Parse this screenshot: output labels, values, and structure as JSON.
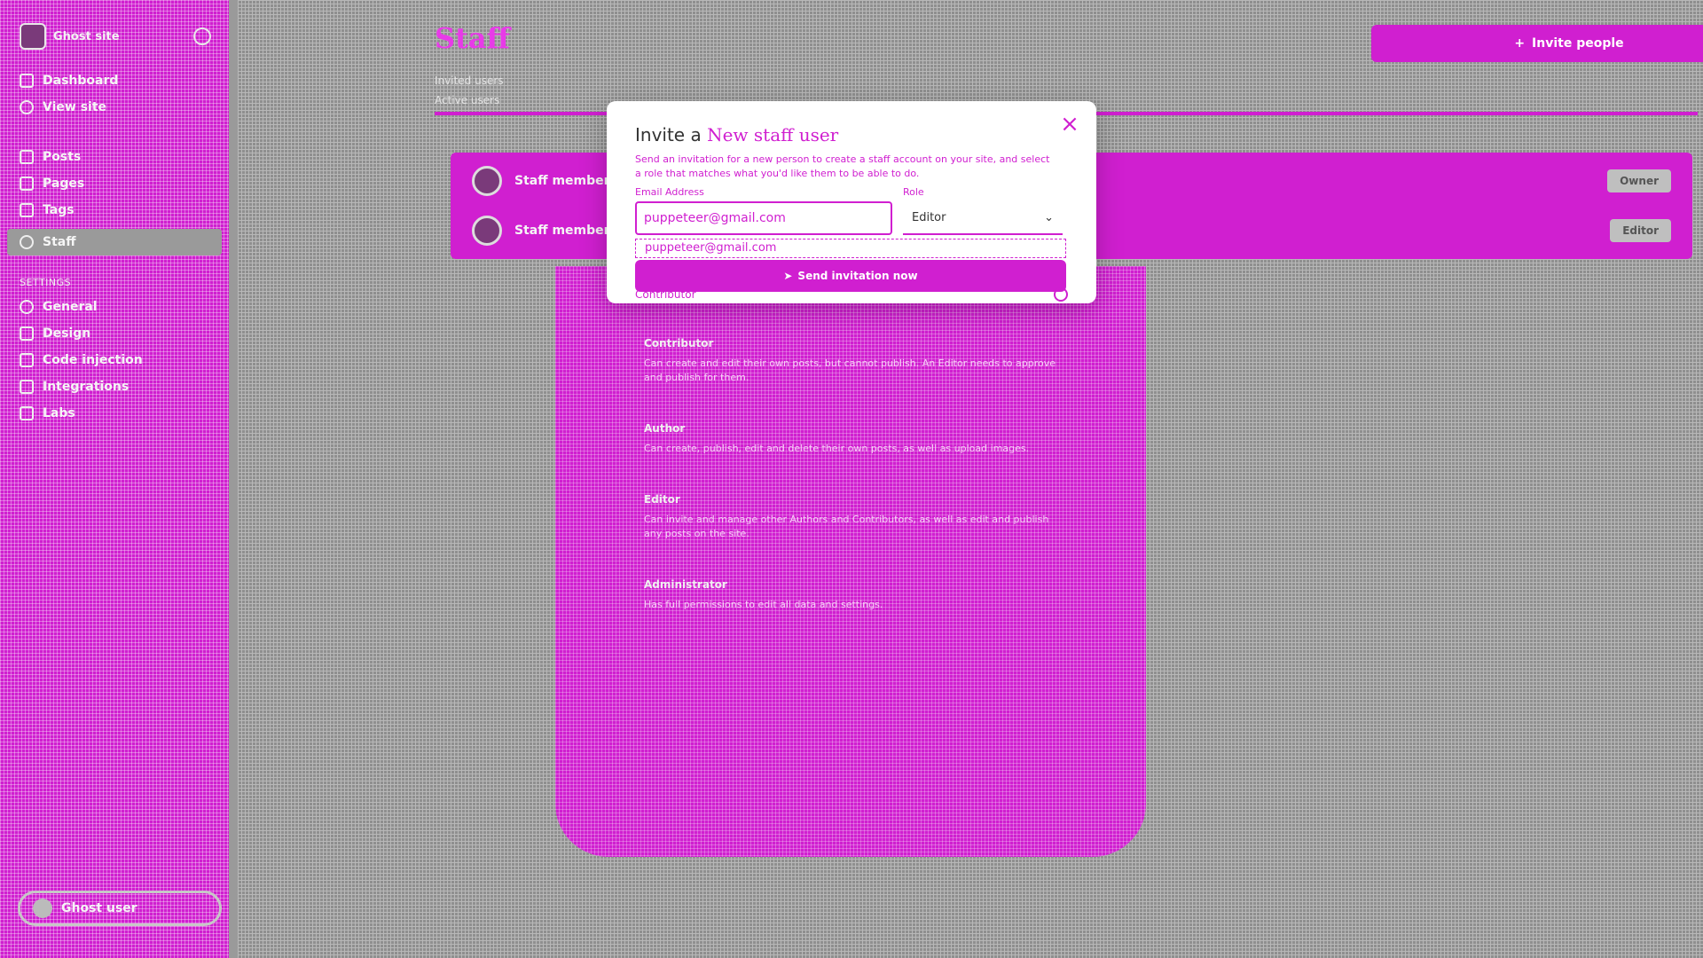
{
  "sidebar": {
    "site_name": "Ghost site",
    "items_top": [
      "Dashboard",
      "View site"
    ],
    "items_main": [
      "Posts",
      "Pages",
      "Tags",
      "Staff"
    ],
    "section_label": "SETTINGS",
    "items_settings": [
      "General",
      "Design",
      "Code injection",
      "Integrations",
      "Labs"
    ],
    "footer_label": "Ghost user"
  },
  "main": {
    "page_title": "Staff",
    "invite_button": "Invite people",
    "subtabs": [
      "Invited users",
      "Active users"
    ],
    "staff": [
      {
        "name": "Staff member",
        "role": "Owner"
      },
      {
        "name": "Staff member",
        "role": "Editor"
      }
    ]
  },
  "roles_panel": {
    "roles": [
      {
        "name": "Contributor",
        "desc": "Can create and edit their own posts, but cannot publish. An Editor needs to approve and publish for them."
      },
      {
        "name": "Author",
        "desc": "Can create, publish, edit and delete their own posts, as well as upload images."
      },
      {
        "name": "Editor",
        "desc": "Can invite and manage other Authors and Contributors, as well as edit and publish any posts on the site."
      },
      {
        "name": "Administrator",
        "desc": "Has full permissions to edit all data and settings."
      }
    ]
  },
  "modal": {
    "title_plain": "Invite a",
    "title_accent": "New staff user",
    "description": "Send an invitation for a new person to create a staff account on your site, and select a role that matches what you'd like them to be able to do.",
    "email_label": "Email Address",
    "email_value": "puppeteer@gmail.com",
    "role_label": "Role",
    "role_value": "Editor",
    "autocomplete_value": "puppeteer@gmail.com",
    "send_label": "Send invitation now",
    "contributor_label": "Contributor",
    "close_symbol": "×"
  },
  "colors": {
    "accent": "#d01fd0",
    "background": "#8f8f8f"
  }
}
